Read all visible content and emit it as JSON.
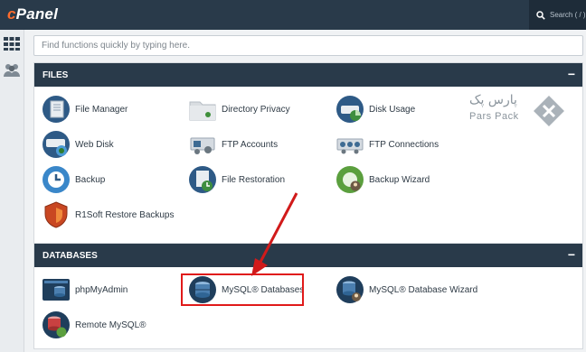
{
  "app": {
    "logo": "cPanel"
  },
  "search": {
    "placeholder": "Search ( / )"
  },
  "quickfind": {
    "placeholder": "Find functions quickly by typing here."
  },
  "files": {
    "title": "FILES",
    "toggle": "−",
    "items": [
      {
        "label": "File Manager",
        "icon": "file-manager-icon"
      },
      {
        "label": "Directory Privacy",
        "icon": "directory-privacy-icon"
      },
      {
        "label": "Disk Usage",
        "icon": "disk-usage-icon"
      },
      {
        "label": "Web Disk",
        "icon": "web-disk-icon"
      },
      {
        "label": "FTP Accounts",
        "icon": "ftp-accounts-icon"
      },
      {
        "label": "FTP Connections",
        "icon": "ftp-connections-icon"
      },
      {
        "label": "Backup",
        "icon": "backup-icon"
      },
      {
        "label": "File Restoration",
        "icon": "file-restoration-icon"
      },
      {
        "label": "Backup Wizard",
        "icon": "backup-wizard-icon"
      },
      {
        "label": "R1Soft Restore Backups",
        "icon": "r1soft-icon"
      }
    ]
  },
  "databases": {
    "title": "DATABASES",
    "toggle": "−",
    "items": [
      {
        "label": "phpMyAdmin",
        "icon": "phpmyadmin-icon"
      },
      {
        "label": "MySQL® Databases",
        "icon": "mysql-databases-icon"
      },
      {
        "label": "MySQL® Database Wizard",
        "icon": "mysql-wizard-icon"
      },
      {
        "label": "Remote MySQL®",
        "icon": "remote-mysql-icon"
      }
    ]
  },
  "brand": {
    "persian": "پارس پک",
    "latin": "Pars Pack"
  },
  "colors": {
    "topbar": "#293a4a",
    "accent": "#ff6c2c",
    "highlight": "#e01a1a",
    "arrow": "#d11a1a"
  }
}
